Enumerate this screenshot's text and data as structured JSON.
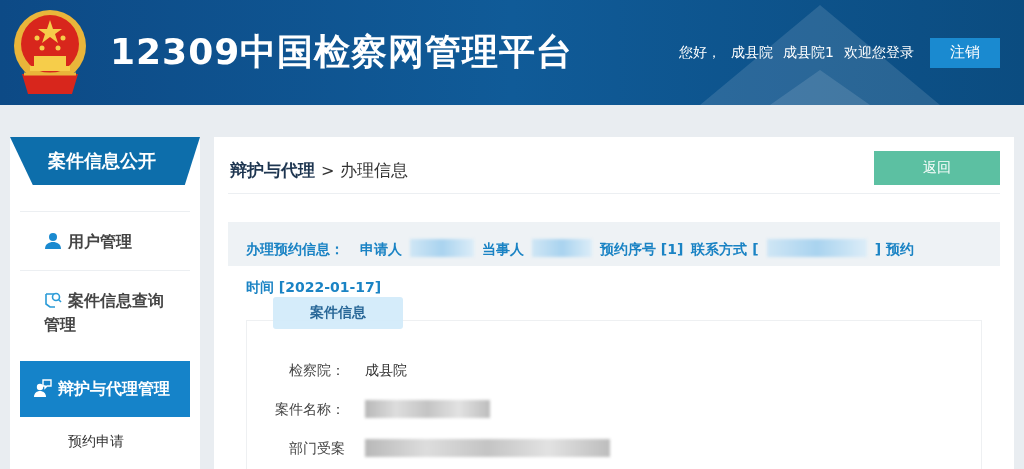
{
  "header": {
    "title": "12309中国检察网管理平台",
    "greeting": "您好，",
    "org": "成县院",
    "user": "成县院1",
    "welcome": "欢迎您登录",
    "logout": "注销"
  },
  "sidebar": {
    "title": "案件信息公开",
    "items": [
      {
        "label": "用户管理",
        "selected": false
      },
      {
        "label": "案件信息查询管理",
        "selected": false
      },
      {
        "label": "辩护与代理管理",
        "selected": true
      }
    ],
    "subitems": [
      {
        "label": "预约申请",
        "selected": false
      }
    ]
  },
  "breadcrumb": {
    "section": "辩护与代理",
    "separator": ">",
    "page": "办理信息"
  },
  "back_button": "返回",
  "info_line": [
    {
      "kind": "label",
      "text": "办理预约信息："
    },
    {
      "kind": "text",
      "text": "申请人"
    },
    {
      "kind": "blur"
    },
    {
      "kind": "text",
      "text": "当事人"
    },
    {
      "kind": "blur"
    },
    {
      "kind": "text",
      "text": "预约序号 [1]"
    },
    {
      "kind": "text",
      "text": "联系方式 ["
    },
    {
      "kind": "blur"
    },
    {
      "kind": "text",
      "text": "] 预约"
    },
    {
      "kind": "text",
      "text": "时间 [2022-01-17]"
    }
  ],
  "card": {
    "tab": "案件信息",
    "fields": [
      {
        "kind": "text",
        "label": "检察院：",
        "value": "成县院"
      },
      {
        "kind": "blur",
        "label": "案件名称："
      },
      {
        "kind": "blur",
        "label": "部门受案"
      }
    ]
  }
}
